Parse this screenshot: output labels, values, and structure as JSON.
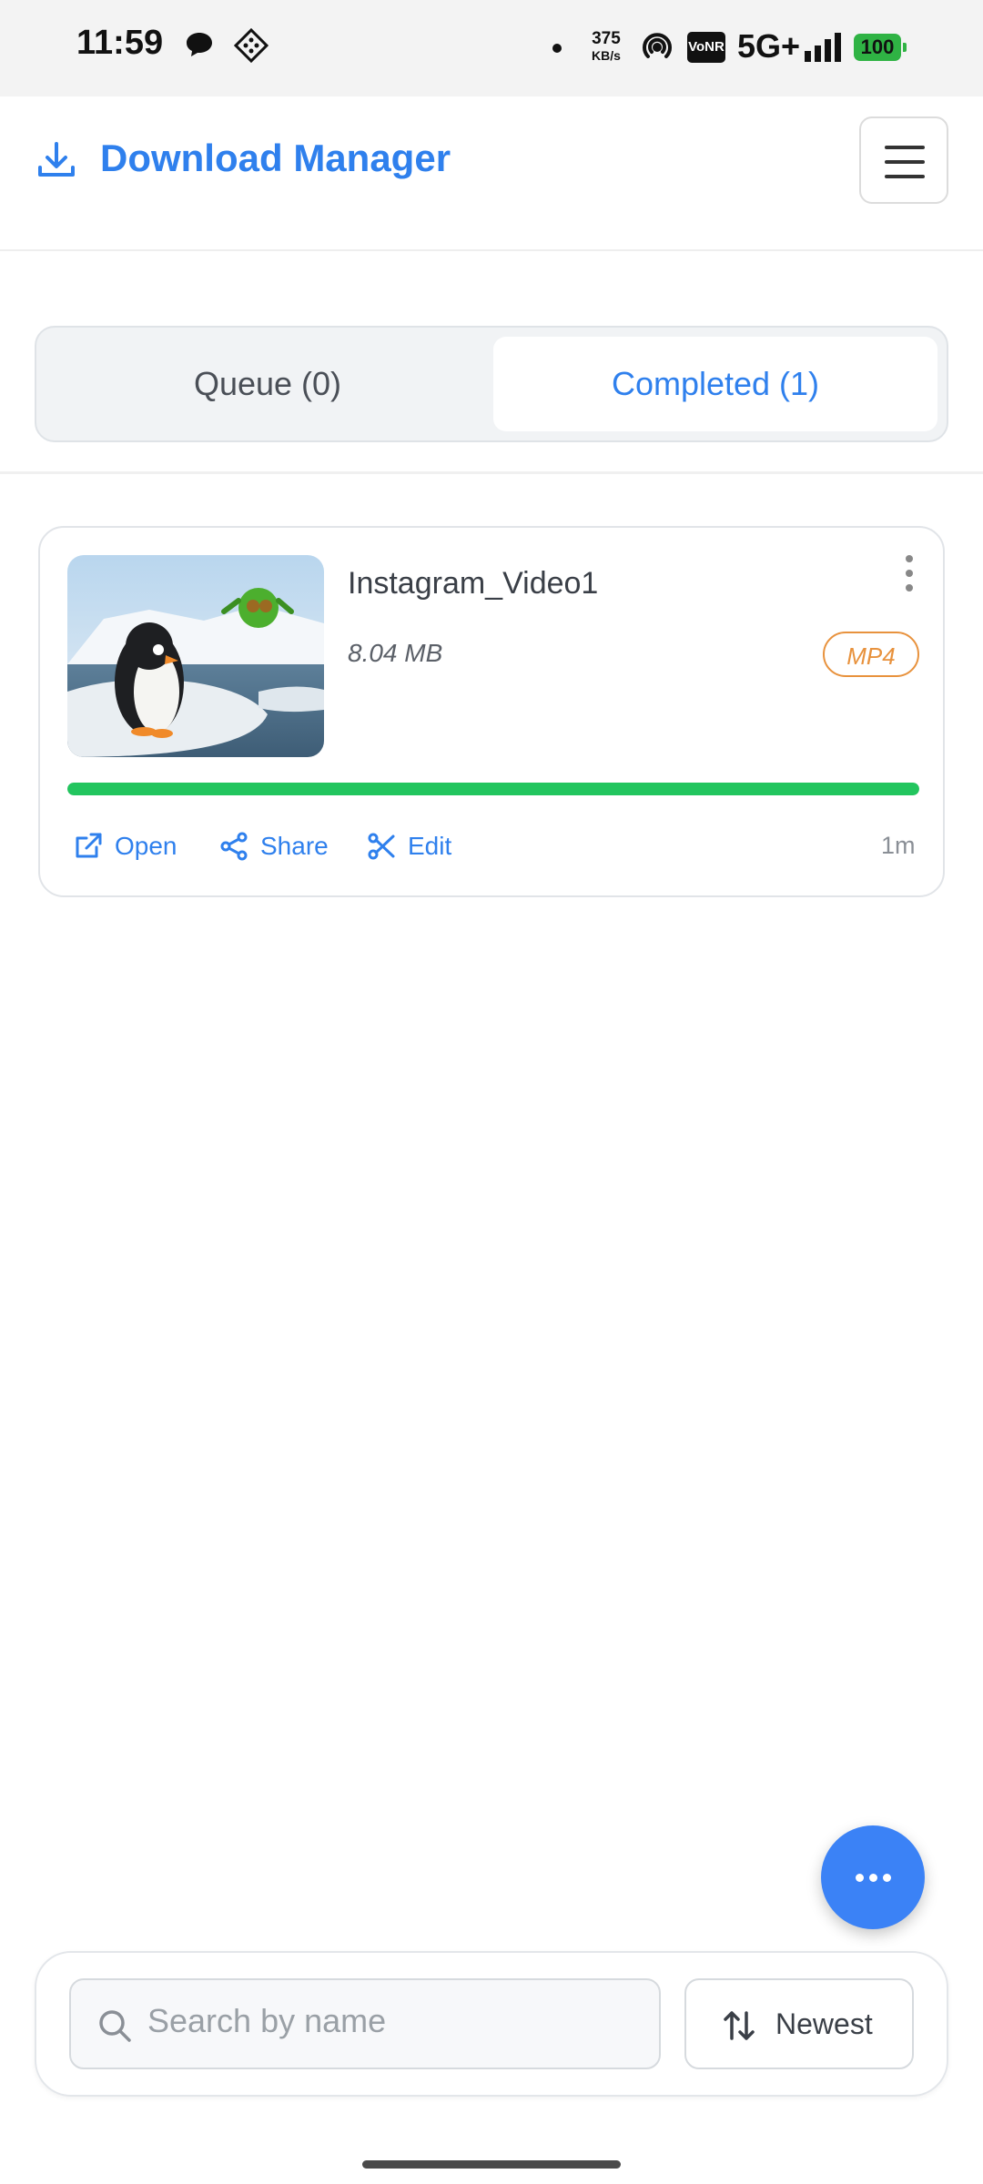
{
  "status_bar": {
    "time": "11:59",
    "speed_top": "375",
    "speed_unit": "KB/s",
    "vonr": "VoNR",
    "network": "5G+",
    "battery": "100"
  },
  "header": {
    "title": "Download Manager"
  },
  "tabs": [
    {
      "label": "Queue (0)",
      "active": false
    },
    {
      "label": "Completed (1)",
      "active": true
    }
  ],
  "downloads": [
    {
      "name": "Instagram_Video1",
      "size": "8.04 MB",
      "format": "MP4",
      "progress": 1.0,
      "time_ago": "1m",
      "actions": [
        "Open",
        "Share",
        "Edit"
      ]
    }
  ],
  "search": {
    "placeholder": "Search by name"
  },
  "sort": {
    "label": "Newest"
  },
  "colors": {
    "accent": "#2f80ed",
    "progress": "#22c55e",
    "badge": "#e8923d",
    "fab": "#3b82f6"
  }
}
